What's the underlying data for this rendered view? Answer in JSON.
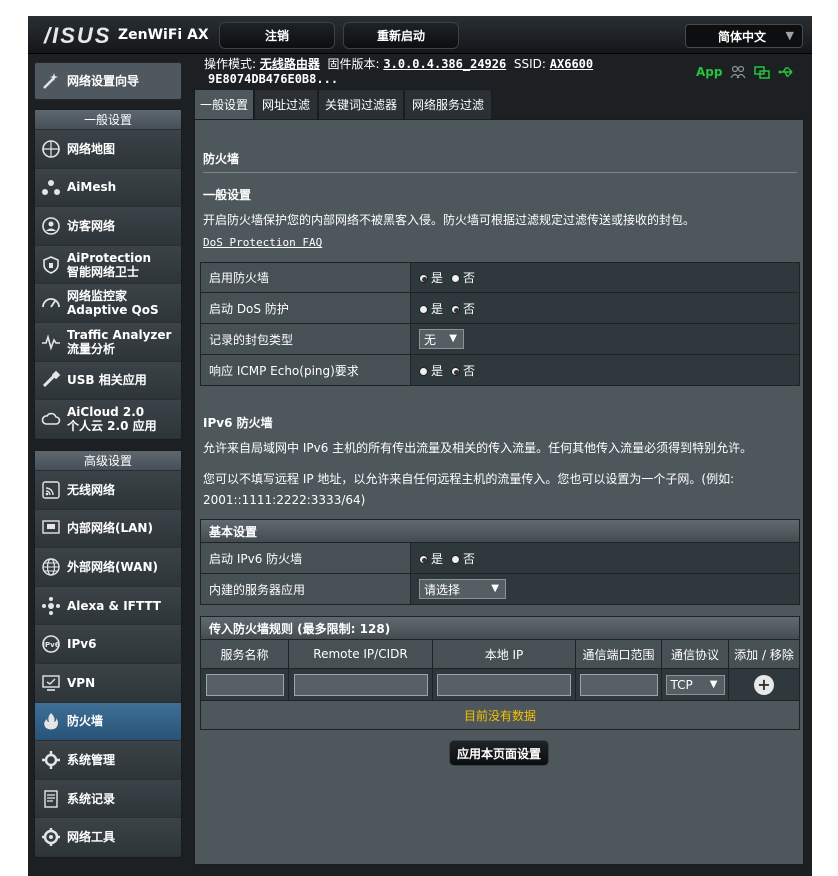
{
  "header": {
    "logo": "/ISUS",
    "model": "ZenWiFi AX",
    "logout_label": "注销",
    "reboot_label": "重新启动",
    "language": "简体中文"
  },
  "status": {
    "mode_label": "操作模式:",
    "mode_value": "无线路由器",
    "fw_label": "固件版本:",
    "fw_value": "3.0.0.4.386_24926",
    "ssid_label": "SSID:",
    "ssid_value": "AX6600",
    "mac_value": "9E8074DB476E0B8...",
    "app_label": "App"
  },
  "sidebar": {
    "wizard": "网络设置向导",
    "general_head": "一般设置",
    "general_items": [
      {
        "label": "网络地图",
        "icon": "network-map-icon"
      },
      {
        "label": "AiMesh",
        "icon": "aimesh-icon"
      },
      {
        "label": "访客网络",
        "icon": "guest-network-icon"
      },
      {
        "label": "AiProtection\n智能网络卫士",
        "icon": "shield-icon"
      },
      {
        "label": "网络监控家\nAdaptive QoS",
        "icon": "gauge-icon"
      },
      {
        "label": "Traffic Analyzer\n流量分析",
        "icon": "pulse-icon"
      },
      {
        "label": "USB 相关应用",
        "icon": "usb-icon"
      },
      {
        "label": "AiCloud 2.0\n个人云 2.0 应用",
        "icon": "cloud-icon"
      }
    ],
    "advanced_head": "高级设置",
    "advanced_items": [
      {
        "label": "无线网络",
        "icon": "wireless-icon"
      },
      {
        "label": "内部网络(LAN)",
        "icon": "lan-icon"
      },
      {
        "label": "外部网络(WAN)",
        "icon": "globe-icon"
      },
      {
        "label": "Alexa & IFTTT",
        "icon": "alexa-icon"
      },
      {
        "label": "IPv6",
        "icon": "ipv6-icon"
      },
      {
        "label": "VPN",
        "icon": "vpn-icon"
      },
      {
        "label": "防火墙",
        "icon": "firewall-icon"
      },
      {
        "label": "系统管理",
        "icon": "admin-icon"
      },
      {
        "label": "系统记录",
        "icon": "log-icon"
      },
      {
        "label": "网络工具",
        "icon": "tools-icon"
      }
    ]
  },
  "tabs": [
    "一般设置",
    "网址过滤",
    "关键词过滤器",
    "网络服务过滤"
  ],
  "content": {
    "title": "防火墙",
    "general_title": "一般设置",
    "desc": "开启防火墙保护您的内部网络不被黑客入侵。防火墙可根据过滤规定过滤传送或接收的封包。",
    "faq": "DoS Protection FAQ",
    "rows": [
      {
        "label": "启用防火墙",
        "yes": "是",
        "no": "否",
        "selected": "yes"
      },
      {
        "label": "启动 DoS 防护",
        "yes": "是",
        "no": "否",
        "selected": "no"
      },
      {
        "label": "记录的封包类型",
        "select": "无"
      },
      {
        "label": "响应 ICMP Echo(ping)要求",
        "yes": "是",
        "no": "否",
        "selected": "no"
      }
    ],
    "ipv6_title": "IPv6 防火墙",
    "ipv6_desc1": "允许来自局域网中 IPv6 主机的所有传出流量及相关的传入流量。任何其他传入流量必须得到特别允许。",
    "ipv6_desc2": "您可以不填写远程 IP 地址，以允许来自任何远程主机的流量传入。您也可以设置为一个子网。(例如: 2001::1111:2222:3333/64)",
    "basic_head": "基本设置",
    "basic_rows": [
      {
        "label": "启动 IPv6 防火墙",
        "yes": "是",
        "no": "否",
        "selected": "yes"
      },
      {
        "label": "内建的服务器应用",
        "select": "请选择"
      }
    ],
    "rules_head": "传入防火墙规则 (最多限制: 128)",
    "rules_columns": [
      "服务名称",
      "Remote IP/CIDR",
      "本地 IP",
      "通信端口范围",
      "通信协议",
      "添加 / 移除"
    ],
    "protocol_value": "TCP",
    "no_data": "目前没有数据",
    "apply_label": "应用本页面设置"
  }
}
